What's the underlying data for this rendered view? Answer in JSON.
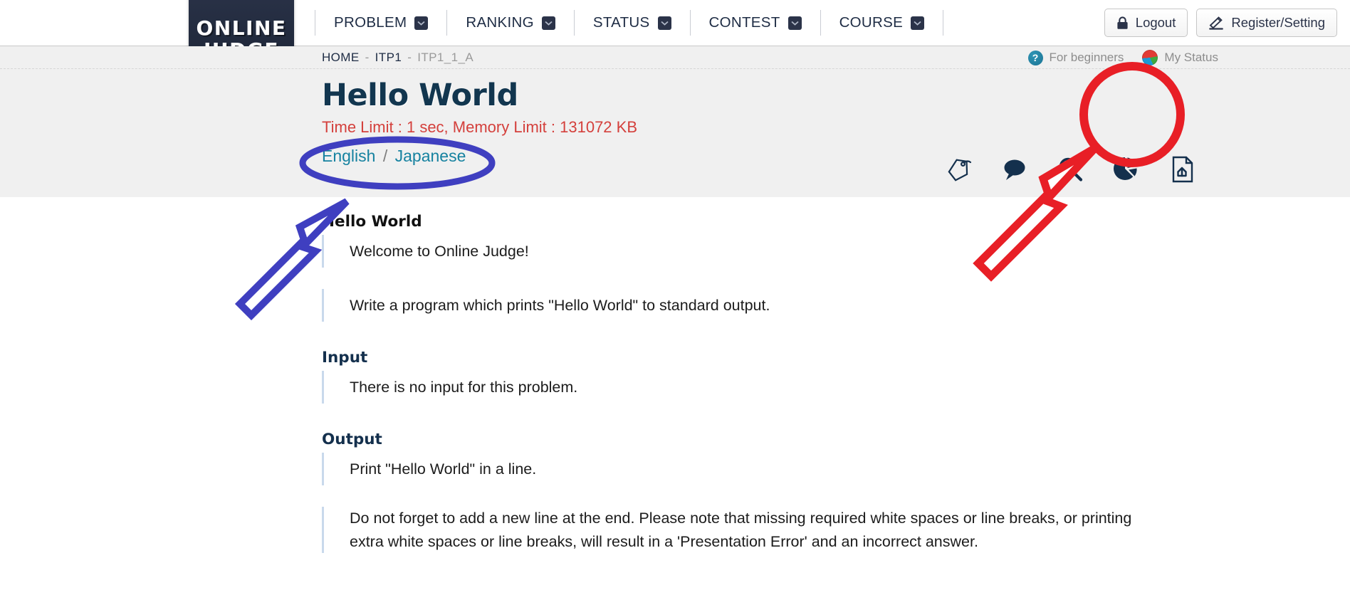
{
  "brand": {
    "line1": "ONLINE",
    "line2": "JUDGE"
  },
  "nav": {
    "items": [
      {
        "label": "PROBLEM",
        "has_caret": true
      },
      {
        "label": "RANKING",
        "has_caret": true
      },
      {
        "label": "STATUS",
        "has_caret": true
      },
      {
        "label": "CONTEST",
        "has_caret": true
      },
      {
        "label": "COURSE",
        "has_caret": true
      }
    ],
    "buttons": [
      {
        "label": "Logout",
        "icon": "lock-icon"
      },
      {
        "label": "Register/Setting",
        "icon": "pencil-icon"
      }
    ]
  },
  "breadcrumb": {
    "items": [
      {
        "label": "HOME",
        "current": false
      },
      {
        "label": "ITP1",
        "current": false
      },
      {
        "label": "ITP1_1_A",
        "current": true
      }
    ],
    "separator": "-",
    "links": [
      {
        "label": "For beginners",
        "icon": "question-badge-icon"
      },
      {
        "label": "My Status",
        "icon": "pie-badge-icon"
      }
    ]
  },
  "problem": {
    "title": "Hello World",
    "limits": "Time Limit : 1 sec, Memory Limit : 131072 KB",
    "languages": {
      "english": "English",
      "slash": "/",
      "japanese": "Japanese"
    },
    "icons": [
      {
        "name": "tag-icon",
        "highlighted": false
      },
      {
        "name": "comment-icon",
        "highlighted": false
      },
      {
        "name": "search-icon",
        "highlighted": false
      },
      {
        "name": "pie-chart-icon",
        "highlighted": false
      },
      {
        "name": "file-upload-icon",
        "highlighted": true
      }
    ]
  },
  "body": {
    "sections": [
      {
        "heading": "Hello World",
        "heading_style": "plain",
        "paragraphs": [
          "Welcome to Online Judge!",
          "Write a program which prints \"Hello World\" to standard output."
        ]
      },
      {
        "heading": "Input",
        "heading_style": "navy",
        "paragraphs": [
          "There is no input for this problem."
        ]
      },
      {
        "heading": "Output",
        "heading_style": "navy",
        "paragraphs": [
          "Print \"Hello World\" in a line.",
          "Do not forget to add a new line at the end. Please note that missing required white spaces or line breaks, or printing extra white spaces or line breaks, will result in a 'Presentation Error' and an incorrect answer."
        ]
      }
    ]
  },
  "annotations": [
    {
      "name": "language-links-ellipse",
      "shape": "ellipse",
      "color": "#3f3fc0",
      "target": "English / Japanese"
    },
    {
      "name": "language-links-arrow",
      "shape": "arrow",
      "color": "#3f3fc0",
      "target": "English / Japanese"
    },
    {
      "name": "submit-icon-circle",
      "shape": "circle",
      "color": "#e81f26",
      "target": "file-upload-icon"
    },
    {
      "name": "submit-icon-arrow",
      "shape": "arrow",
      "color": "#e81f26",
      "target": "file-upload-icon"
    }
  ],
  "colors": {
    "brand_navy": "#2b3349",
    "title_navy": "#12364f",
    "limits_red": "#d4403c",
    "link_teal": "#1682a0",
    "band_gray": "#f0f0f0",
    "anno_blue": "#3f3fc0",
    "anno_red": "#e81f26"
  }
}
